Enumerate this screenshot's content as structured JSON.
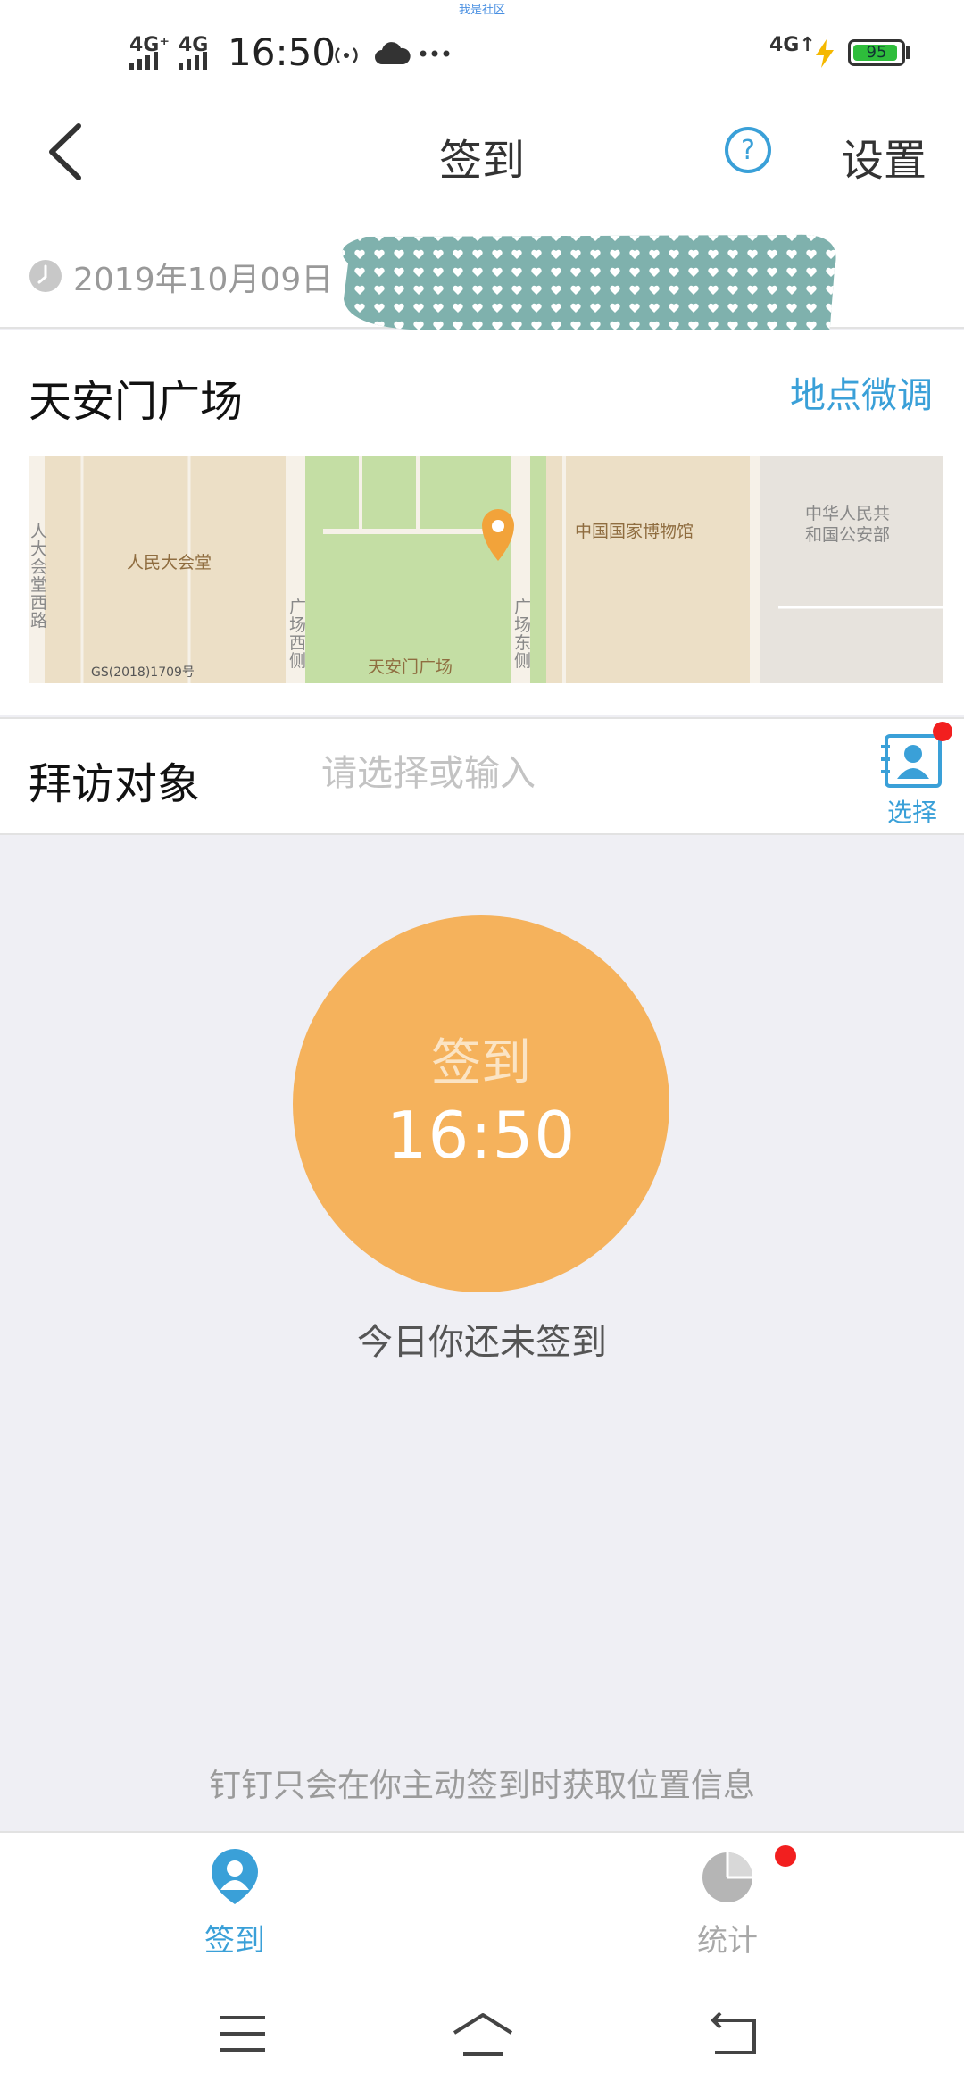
{
  "watermark": "我是社区",
  "status_bar": {
    "signal_1": "4G⁺",
    "signal_2": "4G",
    "time": "16:50",
    "signal_3": "4G↑",
    "battery": "95"
  },
  "nav": {
    "title": "签到",
    "settings_label": "设置"
  },
  "date": "2019年10月09日",
  "location": {
    "name": "天安门广场",
    "adjust_label": "地点微调",
    "map_labels": {
      "great_hall": "人民大会堂",
      "museum": "中国国家博物馆",
      "ministry": "中华人民共和国公安部",
      "ministry_line1": "中华人民共",
      "ministry_line2": "和国公安部",
      "square": "天安门广场",
      "west_road": "人大会堂西路",
      "square_west": "广场西侧",
      "square_east": "广场东侧",
      "license": "GS(2018)1709号"
    }
  },
  "visit": {
    "label": "拜访对象",
    "placeholder": "请选择或输入",
    "choose_label": "选择"
  },
  "checkin": {
    "label": "签到",
    "time": "16:50",
    "status": "今日你还未签到",
    "privacy_note": "钉钉只会在你主动签到时获取位置信息"
  },
  "tabs": [
    {
      "label": "签到",
      "icon": "user-pin-icon",
      "active": true
    },
    {
      "label": "统计",
      "icon": "pie-chart-icon",
      "active": false
    }
  ],
  "colors": {
    "accent": "#3aa0d8",
    "checkin_circle": "#f5b25c",
    "badge": "#f21f1f",
    "map_pin": "#f2a33a",
    "battery": "#2ebd3b"
  }
}
